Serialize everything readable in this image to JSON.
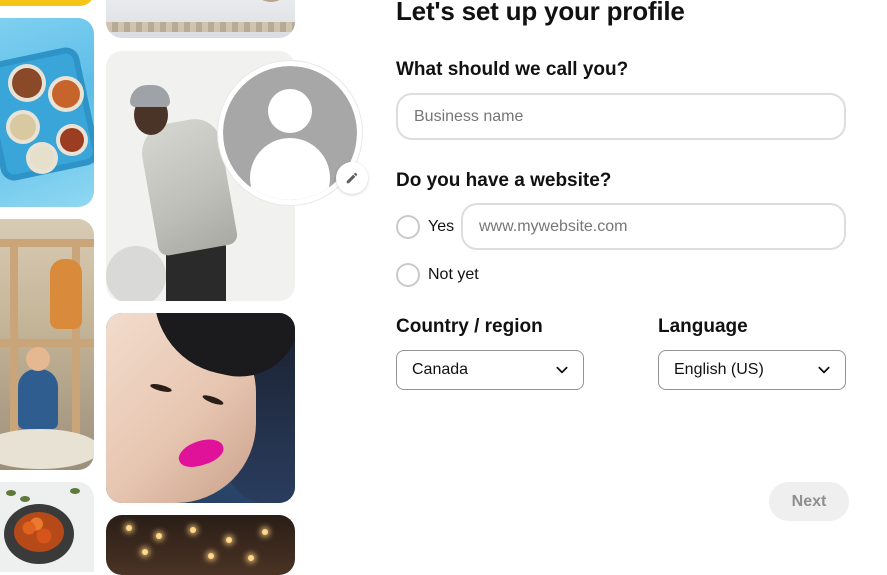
{
  "page": {
    "title": "Let's set up your profile"
  },
  "avatar": {
    "edit_icon": "pencil-icon"
  },
  "form": {
    "name_question": "What should we call you?",
    "name_placeholder": "Business name",
    "name_value": "",
    "website_question": "Do you have a website?",
    "website_option_yes": "Yes",
    "website_option_no": "Not yet",
    "website_placeholder": "www.mywebsite.com",
    "website_value": "",
    "country_label": "Country / region",
    "country_value": "Canada",
    "language_label": "Language",
    "language_value": "English (US)",
    "dropdown_icon": "chevron-down-icon",
    "next_label": "Next"
  },
  "colors": {
    "next_button_bg": "#efefef",
    "next_button_text": "#8e8e8e",
    "avatar_placeholder": "#a7a7a7",
    "input_border": "#dddddd"
  }
}
